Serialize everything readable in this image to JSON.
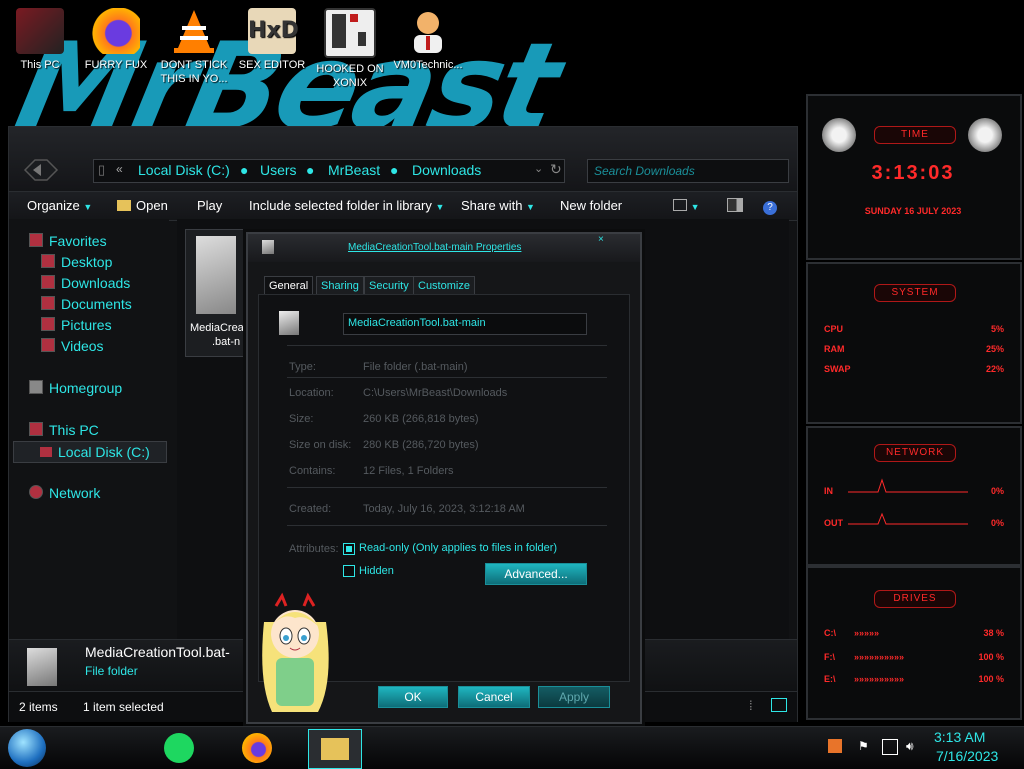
{
  "desktop": {
    "icons": [
      {
        "label": "This PC",
        "icon": "this-pc-icon"
      },
      {
        "label": "FURRY FUX",
        "icon": "firefox-icon"
      },
      {
        "label": "DONT STICK THIS IN YO...",
        "icon": "vlc-icon"
      },
      {
        "label": "SEX EDITOR",
        "icon": "hex-editor-icon"
      },
      {
        "label": "HOOKED ON XONIX",
        "icon": "xonix-icon"
      },
      {
        "label": "VM0Technic...",
        "icon": "user-icon"
      }
    ]
  },
  "explorer": {
    "address": {
      "path": [
        "Local Disk (C:)",
        "Users",
        "MrBeast",
        "Downloads"
      ]
    },
    "search": {
      "placeholder": "Search Downloads"
    },
    "toolbar": {
      "organize": "Organize",
      "open": "Open",
      "play": "Play",
      "include": "Include selected folder in library",
      "share": "Share with",
      "new_folder": "New folder"
    },
    "nav": {
      "favorites": "Favorites",
      "desktop": "Desktop",
      "downloads": "Downloads",
      "documents": "Documents",
      "pictures": "Pictures",
      "videos": "Videos",
      "homegroup": "Homegroup",
      "this_pc": "This PC",
      "local_disk": "Local Disk (C:)",
      "network": "Network"
    },
    "file_tile": {
      "line1": "MediaCrea",
      "line2": ".bat-n"
    },
    "details": {
      "name": "MediaCreationTool.bat-",
      "type": "File folder"
    },
    "status": {
      "items": "2 items",
      "selected": "1 item selected"
    }
  },
  "dialog": {
    "title": "MediaCreationTool.bat-main Properties",
    "tabs": [
      "General",
      "Sharing",
      "Security",
      "Customize"
    ],
    "name_value": "MediaCreationTool.bat-main",
    "props": [
      {
        "label": "Type:",
        "value": "File folder (.bat-main)"
      },
      {
        "label": "Location:",
        "value": "C:\\Users\\MrBeast\\Downloads"
      },
      {
        "label": "Size:",
        "value": "260 KB (266,818 bytes)"
      },
      {
        "label": "Size on disk:",
        "value": "280 KB (286,720 bytes)"
      },
      {
        "label": "Contains:",
        "value": "12 Files, 1 Folders"
      },
      {
        "label": "Created:",
        "value": "Today, July 16, 2023, 3:12:18 AM"
      }
    ],
    "attributes_label": "Attributes:",
    "readonly_label": "Read-only (Only applies to files in folder)",
    "hidden_label": "Hidden",
    "advanced_label": "Advanced...",
    "ok_label": "OK",
    "cancel_label": "Cancel",
    "apply_label": "Apply"
  },
  "widgets": {
    "time": {
      "title": "TIME",
      "clock": "3:13:03",
      "date": "SUNDAY 16 JULY 2023"
    },
    "system": {
      "title": "SYSTEM",
      "rows": [
        {
          "label": "CPU",
          "value": "5%"
        },
        {
          "label": "RAM",
          "value": "25%"
        },
        {
          "label": "SWAP",
          "value": "22%"
        }
      ]
    },
    "network": {
      "title": "NETWORK",
      "rows": [
        {
          "label": "IN",
          "value": "0%"
        },
        {
          "label": "OUT",
          "value": "0%"
        }
      ]
    },
    "drives": {
      "title": "DRIVES",
      "rows": [
        {
          "label": "C:\\",
          "value": "38 %"
        },
        {
          "label": "F:\\",
          "value": "100 %"
        },
        {
          "label": "E:\\",
          "value": "100 %"
        }
      ]
    }
  },
  "taskbar": {
    "time": "3:13 AM",
    "date": "7/16/2023"
  },
  "colors": {
    "accent": "#2ee6e6",
    "widget_red": "#ff2a2a",
    "wallpaper_blue": "#1aa3c2"
  }
}
